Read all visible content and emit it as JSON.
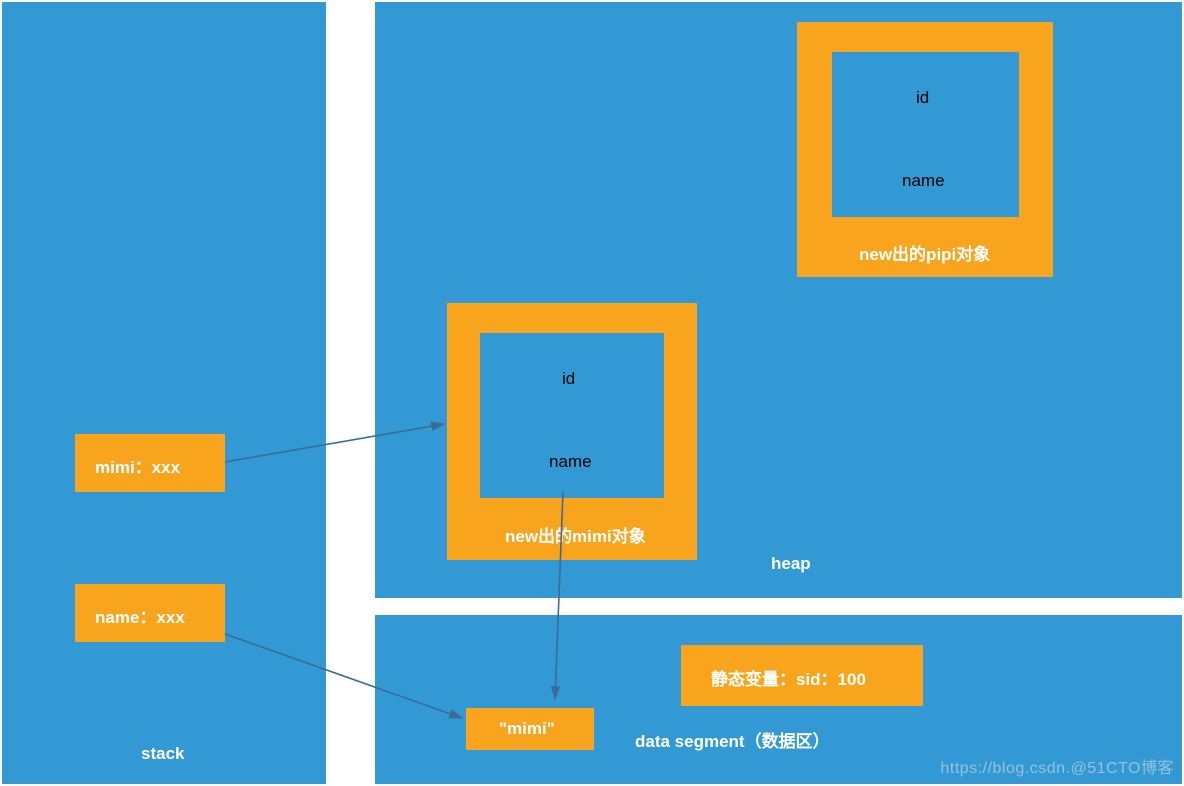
{
  "stack": {
    "label": "stack",
    "mimi_box": "mimi：xxx",
    "name_box": "name：xxx"
  },
  "heap": {
    "label": "heap",
    "mimi_obj": {
      "caption": "new出的mimi对象",
      "field_id": "id",
      "field_name": "name"
    },
    "pipi_obj": {
      "caption": "new出的pipi对象",
      "field_id": "id",
      "field_name": "name"
    }
  },
  "data_segment": {
    "label": "data segment（数据区）",
    "literal": "\"mimi\"",
    "static_var": "静态变量：sid：100"
  },
  "watermark": "https://blog.csdn.@51CTO博客"
}
